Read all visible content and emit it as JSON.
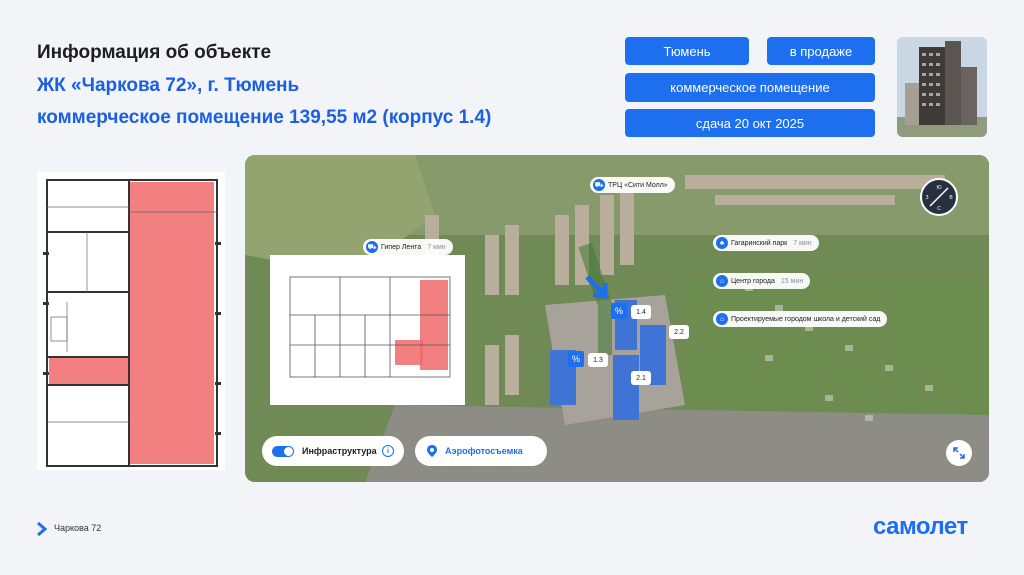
{
  "header": {
    "title": "Информация об объекте",
    "complex": "ЖК «Чаркова 72», г. Тюмень",
    "unit": "коммерческое помещение 139,55 м2 (корпус 1.4)"
  },
  "tags": {
    "city": "Тюмень",
    "status": "в продаже",
    "type": "коммерческое помещение",
    "completion": "сдача 20 окт 2025"
  },
  "map": {
    "labels": [
      {
        "name": "Гипер Лента",
        "time": "7 мин"
      },
      {
        "name": "ТРЦ «Сити Молл»",
        "time": ""
      },
      {
        "name": "Гагаринский парк",
        "time": "7 мин"
      },
      {
        "name": "Центр города",
        "time": "15 мин"
      },
      {
        "name": "Проектируемые городом школа и детский сад",
        "time": ""
      }
    ],
    "buildings": [
      "1.4",
      "2.2",
      "1.3",
      "2.1"
    ],
    "percent_symbol": "%",
    "toggle_label": "Инфраструктура",
    "aerial_label": "Аэрофотосъемка",
    "compass": {
      "n": "Ю",
      "e": "В",
      "w": "З",
      "s": "С"
    }
  },
  "footer": {
    "project": "Чаркова 72",
    "brand": "самолет"
  },
  "colors": {
    "accent": "#1e6ef0",
    "highlight": "#f06a6a"
  }
}
